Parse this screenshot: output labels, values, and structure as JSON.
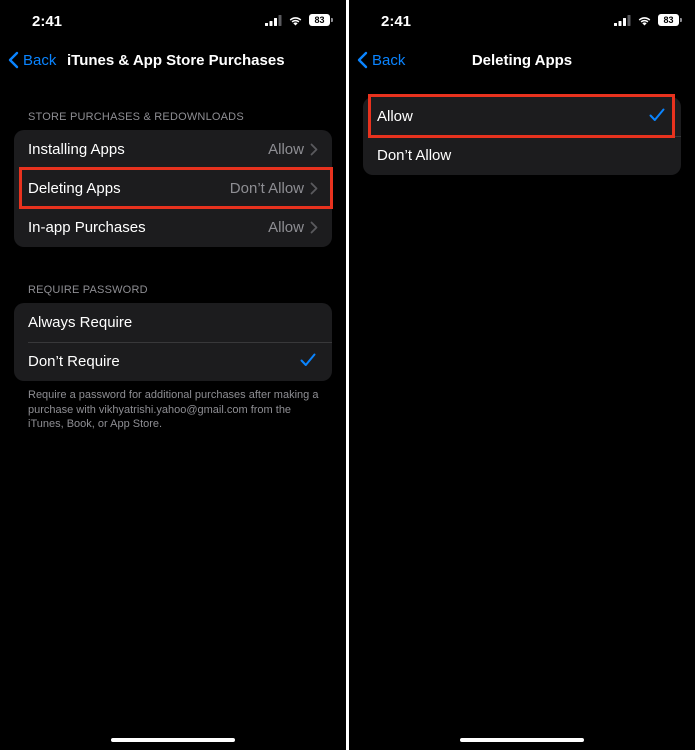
{
  "left": {
    "status": {
      "time": "2:41",
      "battery": "83"
    },
    "nav": {
      "back_label": "Back",
      "title": "iTunes & App Store Purchases"
    },
    "store_section": {
      "header": "STORE PURCHASES & REDOWNLOADS",
      "rows": [
        {
          "label": "Installing Apps",
          "value": "Allow"
        },
        {
          "label": "Deleting Apps",
          "value": "Don’t Allow"
        },
        {
          "label": "In-app Purchases",
          "value": "Allow"
        }
      ]
    },
    "password_section": {
      "header": "REQUIRE PASSWORD",
      "rows": [
        {
          "label": "Always Require"
        },
        {
          "label": "Don’t Require"
        }
      ],
      "selected": "Don’t Require",
      "footer": "Require a password for additional purchases after making a purchase with vikhyatrishi.yahoo@gmail.com from the iTunes, Book, or App Store."
    }
  },
  "right": {
    "status": {
      "time": "2:41",
      "battery": "83"
    },
    "nav": {
      "back_label": "Back",
      "title": "Deleting Apps"
    },
    "options": [
      {
        "label": "Allow"
      },
      {
        "label": "Don’t Allow"
      }
    ],
    "selected": "Allow"
  },
  "colors": {
    "background": "#000000",
    "cell": "#1c1c1e",
    "accent": "#0a84ff",
    "secondary_text": "#8e8e93",
    "highlight": "#e8321e"
  },
  "icons": [
    "signal-icon",
    "wifi-icon",
    "battery-icon",
    "chevron-left-icon",
    "chevron-right-icon",
    "checkmark-icon"
  ]
}
